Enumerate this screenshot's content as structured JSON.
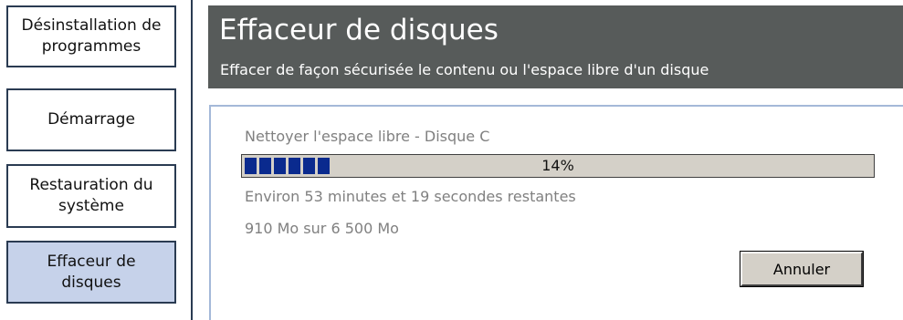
{
  "sidebar": {
    "items": [
      {
        "label": "Désinstallation de\nprogrammes"
      },
      {
        "label": "Démarrage"
      },
      {
        "label": "Restauration du\nsystème"
      },
      {
        "label": "Effaceur de\ndisques"
      }
    ],
    "active_index": 3
  },
  "header": {
    "title": "Effaceur de disques",
    "subtitle": "Effacer de façon sécurisée le contenu ou l'espace libre d'un disque"
  },
  "task": {
    "title": "Nettoyer l'espace libre - Disque C",
    "progress_percent": 14,
    "progress_label": "14%",
    "time_remaining": "Environ 53 minutes et 19 secondes restantes",
    "size_progress": "910 Mo sur 6 500 Mo"
  },
  "buttons": {
    "cancel_label": "Annuler"
  },
  "colors": {
    "header_bg": "#575b5a",
    "active_item_bg": "#c6d2ea",
    "progress_fill": "#0a2a8e",
    "muted_text": "#808080"
  }
}
